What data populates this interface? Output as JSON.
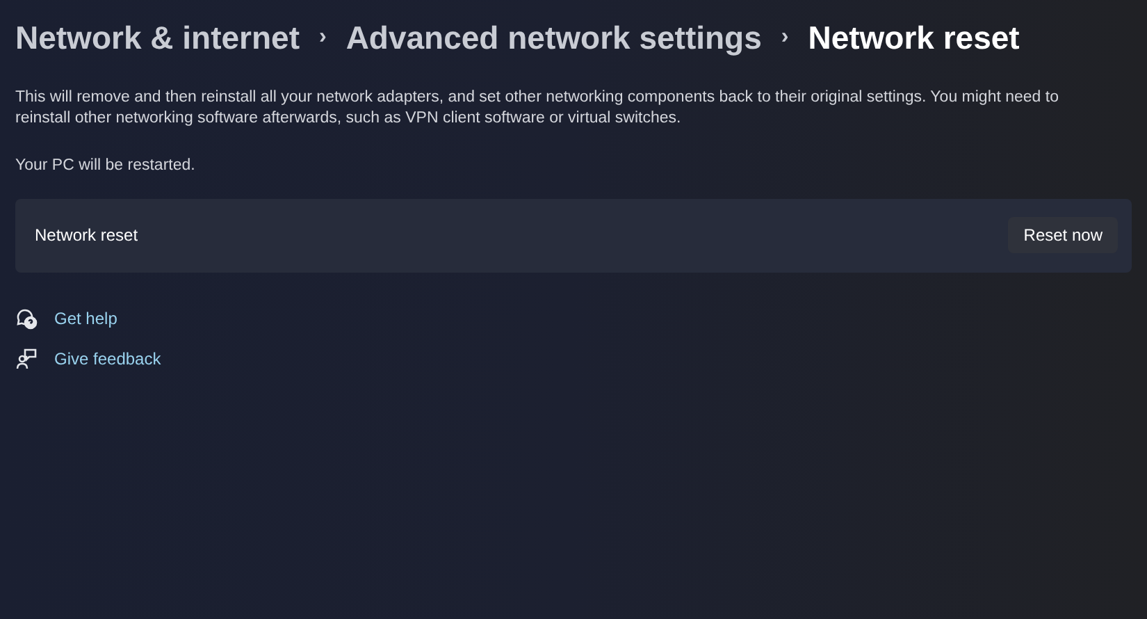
{
  "breadcrumb": [
    {
      "label": "Network & internet",
      "selected": false
    },
    {
      "label": "Advanced network settings",
      "selected": false
    },
    {
      "label": "Network reset",
      "selected": true
    }
  ],
  "separator": "›",
  "description": "This will remove and then reinstall all your network adapters, and set other networking components back to their original settings. You might need to reinstall other networking software afterwards, such as VPN client software or virtual switches.",
  "note": "Your PC will be restarted.",
  "card": {
    "label": "Network reset",
    "button": "Reset now"
  },
  "links": [
    {
      "kind": "help",
      "label": "Get help"
    },
    {
      "kind": "feedback",
      "label": "Give feedback"
    }
  ]
}
